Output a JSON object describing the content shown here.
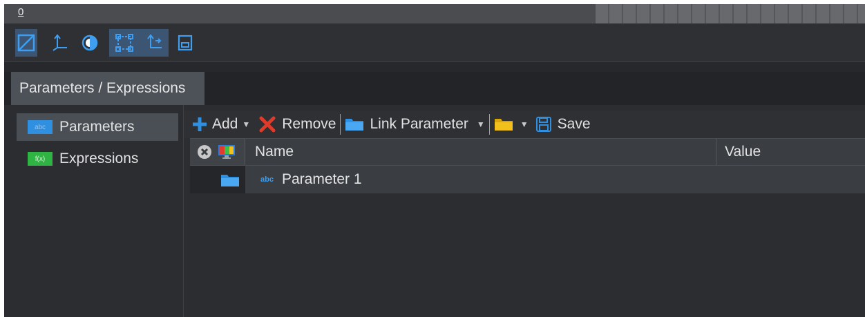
{
  "window": {
    "top_label": "0",
    "tab_title": "Parameters / Expressions"
  },
  "tools": [
    {
      "icon": "square-slash-icon",
      "active": true
    },
    {
      "icon": "axis-arrow-icon",
      "active": false
    },
    {
      "icon": "contrast-circle-icon",
      "active": false
    },
    {
      "icon": "bounding-box-icon",
      "active": true
    },
    {
      "icon": "axis-move-icon",
      "active": true
    },
    {
      "icon": "panel-window-icon",
      "active": false
    }
  ],
  "sidebar": {
    "items": [
      {
        "label": "Parameters",
        "icon": "parameters-icon",
        "icon_text": "abc",
        "selected": true
      },
      {
        "label": "Expressions",
        "icon": "expressions-icon",
        "icon_text": "f(x)",
        "selected": false
      }
    ]
  },
  "toolbar": {
    "add_label": "Add",
    "remove_label": "Remove",
    "link_label": "Link Parameter",
    "save_label": "Save"
  },
  "table": {
    "columns": [
      "Name",
      "Value"
    ],
    "rows": [
      {
        "type_badge": "abc",
        "name": "Parameter 1",
        "value": ""
      }
    ]
  },
  "colors": {
    "accent_blue": "#2f8fe0",
    "remove_red": "#e03a2a",
    "folder_yellow": "#f2c01c",
    "expressions_green": "#2fb443"
  }
}
